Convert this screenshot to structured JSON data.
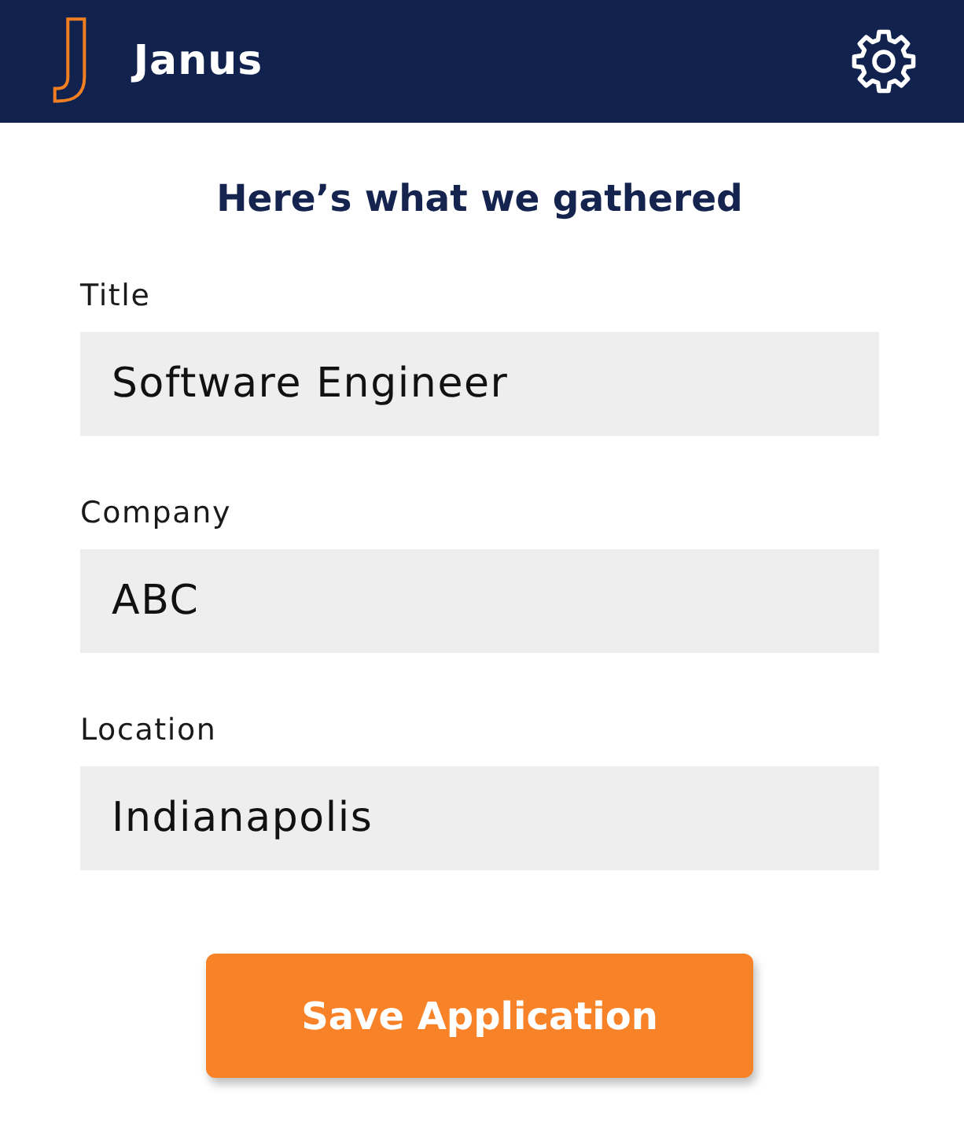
{
  "header": {
    "logo_mark": "J",
    "app_name": "Janus"
  },
  "heading": "Here’s what we gathered",
  "fields": [
    {
      "label": "Title",
      "value": "Software Engineer"
    },
    {
      "label": "Company",
      "value": "ABC"
    },
    {
      "label": "Location",
      "value": "Indianapolis"
    }
  ],
  "save_button": {
    "label": "Save Application"
  }
}
